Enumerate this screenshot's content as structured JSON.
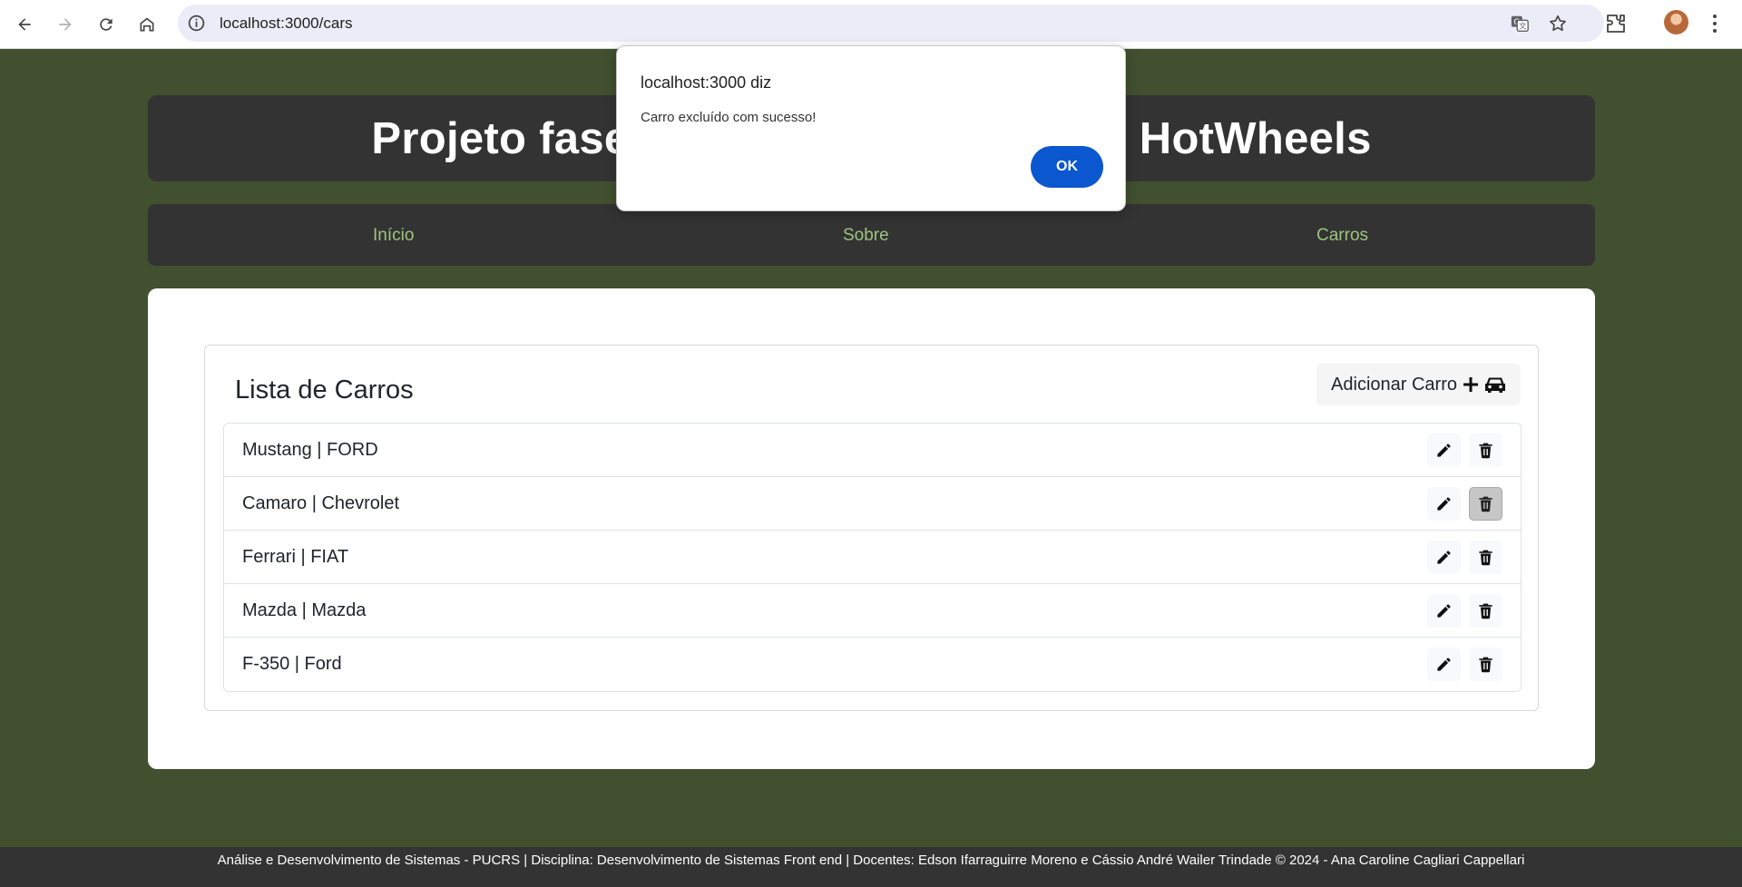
{
  "browser": {
    "url": "localhost:3000/cars",
    "icons": [
      "back-icon",
      "forward-icon",
      "reload-icon",
      "home-icon",
      "site-info-icon",
      "translate-icon",
      "star-icon",
      "extensions-icon",
      "profile-avatar",
      "kebab-menu-icon"
    ]
  },
  "header": {
    "title": "Projeto fase 1 - CRUD de Carrinhos HotWheels"
  },
  "nav": {
    "items": [
      {
        "label": "Início"
      },
      {
        "label": "Sobre"
      },
      {
        "label": "Carros"
      }
    ]
  },
  "card": {
    "title": "Lista de Carros",
    "add_label": "Adicionar Carro",
    "cars": [
      {
        "label": "Mustang | FORD"
      },
      {
        "label": "Camaro | Chevrolet"
      },
      {
        "label": "Ferrari | FIAT"
      },
      {
        "label": "Mazda | Mazda"
      },
      {
        "label": "F-350 | Ford"
      }
    ]
  },
  "footer": {
    "text": "Análise e Desenvolvimento de Sistemas - PUCRS | Disciplina: Desenvolvimento de Sistemas Front end | Docentes: Edson Ifarraguirre Moreno e Cássio André Wailer Trindade © 2024 - Ana Caroline Cagliari Cappellari"
  },
  "dialog": {
    "title": "localhost:3000 diz",
    "message": "Carro excluído com sucesso!",
    "ok_label": "OK"
  },
  "colors": {
    "page_bg": "#41502f",
    "panel_bg": "#333333",
    "nav_link": "#9ec47f",
    "ok_button": "#0b57d0"
  }
}
